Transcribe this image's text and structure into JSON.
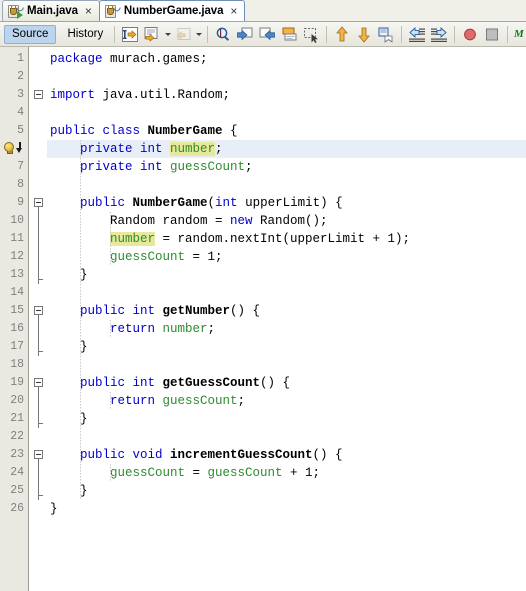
{
  "window": {
    "title": "NetBeans Java Editor"
  },
  "tabs": [
    {
      "label": "Main.java",
      "icon": "java-main-class-icon",
      "active": false,
      "close_label": "×"
    },
    {
      "label": "NumberGame.java",
      "icon": "java-class-icon",
      "active": true,
      "close_label": "×"
    }
  ],
  "toolbar": {
    "source_label": "Source",
    "history_label": "History",
    "buttons": [
      {
        "name": "last-edit-icon"
      },
      {
        "name": "back-navigation-icon"
      },
      {
        "name": "back-dropdown-icon"
      },
      {
        "name": "forward-navigation-icon"
      },
      {
        "name": "forward-dropdown-icon"
      },
      {
        "name": "find-selection-icon"
      },
      {
        "name": "find-previous-icon"
      },
      {
        "name": "find-next-icon"
      },
      {
        "name": "toggle-highlight-icon"
      },
      {
        "name": "toggle-rectangular-selection-icon"
      },
      {
        "name": "previous-bookmark-icon"
      },
      {
        "name": "next-bookmark-icon"
      },
      {
        "name": "toggle-bookmark-icon"
      },
      {
        "name": "shift-line-left-icon"
      },
      {
        "name": "shift-line-right-icon"
      },
      {
        "name": "start-macro-recording-icon"
      },
      {
        "name": "stop-macro-recording-icon"
      },
      {
        "name": "inspect-members-icon"
      }
    ]
  },
  "editor": {
    "current_line": 6,
    "hint_line": 6,
    "hint_icon": "lightbulb-hint-icon",
    "lines": [
      {
        "n": 1,
        "indent": 0,
        "tokens": [
          {
            "t": "package ",
            "c": "kw"
          },
          {
            "t": "murach.games;",
            "c": "pl"
          }
        ]
      },
      {
        "n": 2,
        "indent": 0,
        "tokens": []
      },
      {
        "n": 3,
        "indent": 0,
        "fold": "single",
        "tokens": [
          {
            "t": "import ",
            "c": "kw"
          },
          {
            "t": "java.util.Random;",
            "c": "pl"
          }
        ]
      },
      {
        "n": 4,
        "indent": 0,
        "tokens": []
      },
      {
        "n": 5,
        "indent": 0,
        "tokens": [
          {
            "t": "public class ",
            "c": "kw"
          },
          {
            "t": "NumberGame",
            "c": "cls"
          },
          {
            "t": " {",
            "c": "pl"
          }
        ]
      },
      {
        "n": 6,
        "indent": 1,
        "tokens": [
          {
            "t": "private int ",
            "c": "kw"
          },
          {
            "t": "number",
            "c": "fld hl"
          },
          {
            "t": ";",
            "c": "pl"
          }
        ]
      },
      {
        "n": 7,
        "indent": 1,
        "tokens": [
          {
            "t": "private int ",
            "c": "kw"
          },
          {
            "t": "guessCount",
            "c": "fld"
          },
          {
            "t": ";",
            "c": "pl"
          }
        ]
      },
      {
        "n": 8,
        "indent": 0,
        "tokens": []
      },
      {
        "n": 9,
        "indent": 1,
        "fold": "start",
        "tokens": [
          {
            "t": "public ",
            "c": "kw"
          },
          {
            "t": "NumberGame",
            "c": "cls"
          },
          {
            "t": "(",
            "c": "pl"
          },
          {
            "t": "int",
            "c": "kw"
          },
          {
            "t": " upperLimit) {",
            "c": "pl"
          }
        ]
      },
      {
        "n": 10,
        "indent": 2,
        "fold": "mid",
        "tokens": [
          {
            "t": "Random random = ",
            "c": "pl"
          },
          {
            "t": "new",
            "c": "kw"
          },
          {
            "t": " Random();",
            "c": "pl"
          }
        ]
      },
      {
        "n": 11,
        "indent": 2,
        "fold": "mid",
        "tokens": [
          {
            "t": "number",
            "c": "fld hl"
          },
          {
            "t": " = random.nextInt(upperLimit + 1);",
            "c": "pl"
          }
        ]
      },
      {
        "n": 12,
        "indent": 2,
        "fold": "mid",
        "tokens": [
          {
            "t": "guessCount",
            "c": "fld"
          },
          {
            "t": " = 1;",
            "c": "pl"
          }
        ]
      },
      {
        "n": 13,
        "indent": 1,
        "fold": "end",
        "tokens": [
          {
            "t": "}",
            "c": "pl"
          }
        ]
      },
      {
        "n": 14,
        "indent": 0,
        "tokens": []
      },
      {
        "n": 15,
        "indent": 1,
        "fold": "start",
        "tokens": [
          {
            "t": "public int ",
            "c": "kw"
          },
          {
            "t": "getNumber",
            "c": "cls"
          },
          {
            "t": "() {",
            "c": "pl"
          }
        ]
      },
      {
        "n": 16,
        "indent": 2,
        "fold": "mid",
        "tokens": [
          {
            "t": "return ",
            "c": "kw"
          },
          {
            "t": "number",
            "c": "fld"
          },
          {
            "t": ";",
            "c": "pl"
          }
        ]
      },
      {
        "n": 17,
        "indent": 1,
        "fold": "end",
        "tokens": [
          {
            "t": "}",
            "c": "pl"
          }
        ]
      },
      {
        "n": 18,
        "indent": 0,
        "tokens": []
      },
      {
        "n": 19,
        "indent": 1,
        "fold": "start",
        "tokens": [
          {
            "t": "public int ",
            "c": "kw"
          },
          {
            "t": "getGuessCount",
            "c": "cls"
          },
          {
            "t": "() {",
            "c": "pl"
          }
        ]
      },
      {
        "n": 20,
        "indent": 2,
        "fold": "mid",
        "tokens": [
          {
            "t": "return ",
            "c": "kw"
          },
          {
            "t": "guessCount",
            "c": "fld"
          },
          {
            "t": ";",
            "c": "pl"
          }
        ]
      },
      {
        "n": 21,
        "indent": 1,
        "fold": "end",
        "tokens": [
          {
            "t": "}",
            "c": "pl"
          }
        ]
      },
      {
        "n": 22,
        "indent": 0,
        "tokens": []
      },
      {
        "n": 23,
        "indent": 1,
        "fold": "start",
        "tokens": [
          {
            "t": "public void ",
            "c": "kw"
          },
          {
            "t": "incrementGuessCount",
            "c": "cls"
          },
          {
            "t": "() {",
            "c": "pl"
          }
        ]
      },
      {
        "n": 24,
        "indent": 2,
        "fold": "mid",
        "tokens": [
          {
            "t": "guessCount",
            "c": "fld"
          },
          {
            "t": " = ",
            "c": "pl"
          },
          {
            "t": "guessCount",
            "c": "fld"
          },
          {
            "t": " + 1;",
            "c": "pl"
          }
        ]
      },
      {
        "n": 25,
        "indent": 1,
        "fold": "end",
        "tokens": [
          {
            "t": "}",
            "c": "pl"
          }
        ]
      },
      {
        "n": 26,
        "indent": 0,
        "tokens": [
          {
            "t": "}",
            "c": "pl"
          }
        ]
      }
    ]
  },
  "colors": {
    "keyword": "#0000cd",
    "field": "#2e8b2e",
    "highlight": "#e8e89a",
    "current_line_bg": "#e8eef8",
    "gutter_bg": "#e9e9e1",
    "toolbar_active": "#bcd4ee"
  }
}
